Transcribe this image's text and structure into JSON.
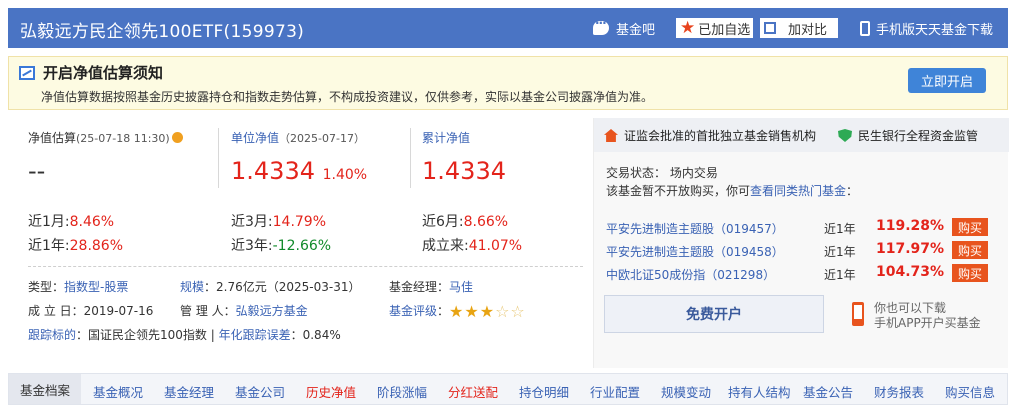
{
  "header": {
    "title": "弘毅远方民企领先100ETF(159973)",
    "forum_label": "基金吧",
    "fav_label": "已加自选",
    "compare_label": "加对比",
    "app_label": "手机版天天基金下载"
  },
  "notice": {
    "title": "开启净值估算须知",
    "text": "净值估算数据按照基金历史披露持仓和指数走势估算，不构成投资建议，仅供参考，实际以基金公司披露净值为准。",
    "button": "立即开启"
  },
  "nav_values": {
    "estimate": {
      "label": "净值估算",
      "date": "(25-07-18 11:30)",
      "value": "--"
    },
    "unit": {
      "label": "单位净值",
      "date": "（2025-07-17）",
      "value": "1.4334",
      "change": "1.40%"
    },
    "cumulative": {
      "label": "累计净值",
      "value": "1.4334"
    }
  },
  "performance": [
    {
      "label": "近1月:",
      "value": "8.46%",
      "trend": "up"
    },
    {
      "label": "近3月:",
      "value": "14.79%",
      "trend": "up"
    },
    {
      "label": "近6月:",
      "value": "8.66%",
      "trend": "up"
    },
    {
      "label": "近1年:",
      "value": "28.86%",
      "trend": "up"
    },
    {
      "label": "近3年:",
      "value": "-12.66%",
      "trend": "down"
    },
    {
      "label": "成立来:",
      "value": "41.07%",
      "trend": "up"
    }
  ],
  "info": {
    "type_label": "类型",
    "type_value": "指数型-股票",
    "scale_label": "规模",
    "scale_value": "：2.76亿元（2025-03-31）",
    "manager_label": "基金经理",
    "manager_value": "马佳",
    "established_label": "成 立 日",
    "established_value": "：2019-07-16",
    "admin_label": "管 理 人",
    "admin_value": "弘毅远方基金",
    "rating_label": "基金评级",
    "rating_stars": 3,
    "tracking_label": "跟踪标的",
    "tracking_value": "：国证民企领先100指数 | ",
    "tracking_error_label": "年化跟踪误差",
    "tracking_error_value": "：0.84%"
  },
  "right_panel": {
    "badge1": "证监会批准的首批独立基金销售机构",
    "badge2": "民生银行全程资金监管",
    "trade_status": "交易状态：   场内交易",
    "not_open_text": "该基金暂不开放购买，你可",
    "hot_link": "查看同类热门基金",
    "colon": "：",
    "funds": [
      {
        "name": "平安先进制造主题股（019457）",
        "period": "近1年",
        "return": "119.28%",
        "buy": "购买"
      },
      {
        "name": "平安先进制造主题股（019458）",
        "period": "近1年",
        "return": "117.97%",
        "buy": "购买"
      },
      {
        "name": "中欧北证50成份指（021298）",
        "period": "近1年",
        "return": "104.73%",
        "buy": "购买"
      }
    ],
    "open_account": "免费开户",
    "app_line1": "你也可以下载",
    "app_line2": "手机APP开户买基金"
  },
  "bottom_nav": [
    {
      "label": "基金档案",
      "highlight": false
    },
    {
      "label": "基金概况",
      "highlight": false
    },
    {
      "label": "基金经理",
      "highlight": false
    },
    {
      "label": "基金公司",
      "highlight": false
    },
    {
      "label": "历史净值",
      "highlight": true
    },
    {
      "label": "阶段涨幅",
      "highlight": false
    },
    {
      "label": "分红送配",
      "highlight": true
    },
    {
      "label": "持仓明细",
      "highlight": false
    },
    {
      "label": "行业配置",
      "highlight": false
    },
    {
      "label": "规模变动",
      "highlight": false
    },
    {
      "label": "持有人结构",
      "highlight": false
    },
    {
      "label": "基金公告",
      "highlight": false
    },
    {
      "label": "财务报表",
      "highlight": false
    },
    {
      "label": "购买信息",
      "highlight": false
    }
  ],
  "colors": {
    "header_bg": "#4a74c4",
    "up": "#e3241b",
    "down": "#118a2a",
    "link": "#3a62b4",
    "buy_bg": "#e8541e"
  }
}
